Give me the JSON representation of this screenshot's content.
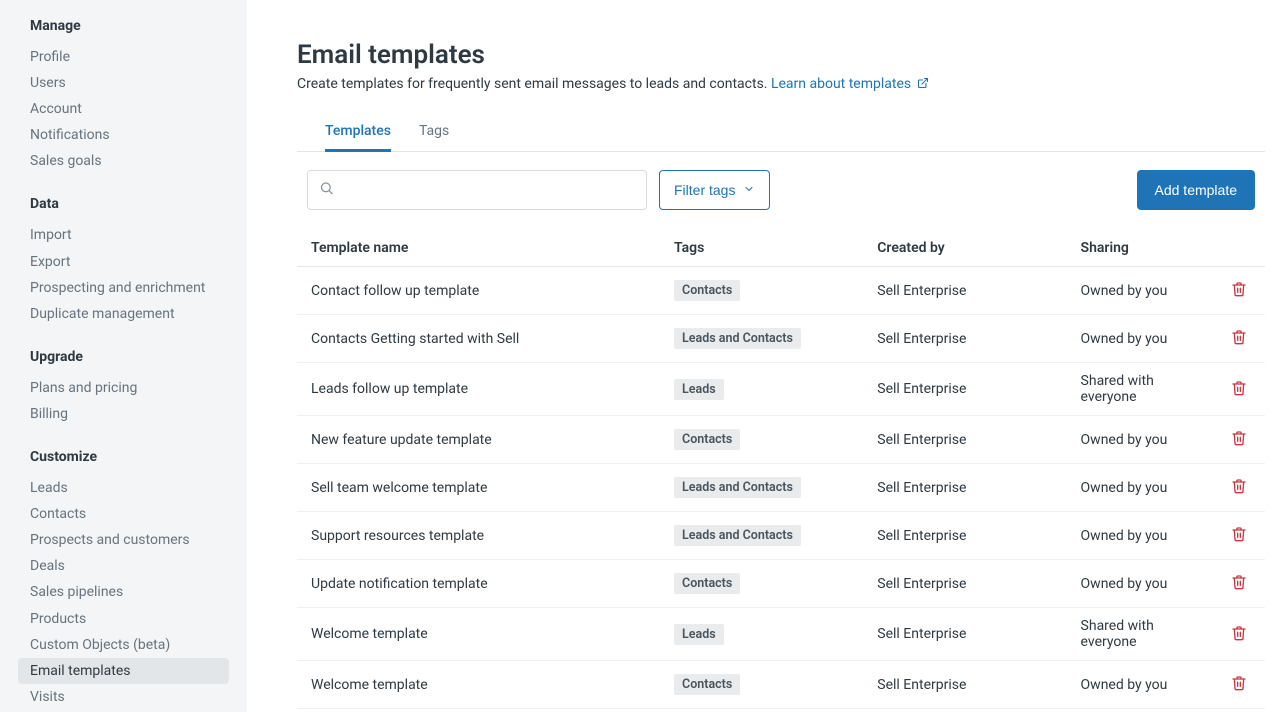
{
  "sidebar": {
    "sections": [
      {
        "heading": "Manage",
        "items": [
          {
            "label": "Profile",
            "name": "sidebar-item-profile",
            "active": false
          },
          {
            "label": "Users",
            "name": "sidebar-item-users",
            "active": false
          },
          {
            "label": "Account",
            "name": "sidebar-item-account",
            "active": false
          },
          {
            "label": "Notifications",
            "name": "sidebar-item-notifications",
            "active": false
          },
          {
            "label": "Sales goals",
            "name": "sidebar-item-sales-goals",
            "active": false
          }
        ]
      },
      {
        "heading": "Data",
        "items": [
          {
            "label": "Import",
            "name": "sidebar-item-import",
            "active": false
          },
          {
            "label": "Export",
            "name": "sidebar-item-export",
            "active": false
          },
          {
            "label": "Prospecting and enrichment",
            "name": "sidebar-item-prospecting",
            "active": false
          },
          {
            "label": "Duplicate management",
            "name": "sidebar-item-duplicates",
            "active": false
          }
        ]
      },
      {
        "heading": "Upgrade",
        "items": [
          {
            "label": "Plans and pricing",
            "name": "sidebar-item-plans",
            "active": false
          },
          {
            "label": "Billing",
            "name": "sidebar-item-billing",
            "active": false
          }
        ]
      },
      {
        "heading": "Customize",
        "items": [
          {
            "label": "Leads",
            "name": "sidebar-item-leads",
            "active": false
          },
          {
            "label": "Contacts",
            "name": "sidebar-item-contacts",
            "active": false
          },
          {
            "label": "Prospects and customers",
            "name": "sidebar-item-prospects",
            "active": false
          },
          {
            "label": "Deals",
            "name": "sidebar-item-deals",
            "active": false
          },
          {
            "label": "Sales pipelines",
            "name": "sidebar-item-pipelines",
            "active": false
          },
          {
            "label": "Products",
            "name": "sidebar-item-products",
            "active": false
          },
          {
            "label": "Custom Objects (beta)",
            "name": "sidebar-item-custom-obj",
            "active": false
          },
          {
            "label": "Email templates",
            "name": "sidebar-item-email-templates",
            "active": true
          },
          {
            "label": "Visits",
            "name": "sidebar-item-visits",
            "active": false
          }
        ]
      }
    ]
  },
  "header": {
    "title": "Email templates",
    "subtitle_prefix": "Create templates for frequently sent email messages to leads and contacts. ",
    "link_text": "Learn about templates"
  },
  "tabs": [
    {
      "label": "Templates",
      "name": "tab-templates",
      "active": true
    },
    {
      "label": "Tags",
      "name": "tab-tags",
      "active": false
    }
  ],
  "toolbar": {
    "search_placeholder": "",
    "filter_label": "Filter tags",
    "add_label": "Add template"
  },
  "table": {
    "columns": {
      "name": "Template name",
      "tags": "Tags",
      "created_by": "Created by",
      "sharing": "Sharing"
    },
    "rows": [
      {
        "name": "Contact follow up template",
        "tag": "Contacts",
        "created_by": "Sell Enterprise",
        "sharing": "Owned by you"
      },
      {
        "name": "Contacts Getting started with Sell",
        "tag": "Leads and Contacts",
        "created_by": "Sell Enterprise",
        "sharing": "Owned by you"
      },
      {
        "name": "Leads follow up template",
        "tag": "Leads",
        "created_by": "Sell Enterprise",
        "sharing": "Shared with everyone"
      },
      {
        "name": "New feature update template",
        "tag": "Contacts",
        "created_by": "Sell Enterprise",
        "sharing": "Owned by you"
      },
      {
        "name": "Sell team welcome template",
        "tag": "Leads and Contacts",
        "created_by": "Sell Enterprise",
        "sharing": "Owned by you"
      },
      {
        "name": "Support resources template",
        "tag": "Leads and Contacts",
        "created_by": "Sell Enterprise",
        "sharing": "Owned by you"
      },
      {
        "name": "Update notification template",
        "tag": "Contacts",
        "created_by": "Sell Enterprise",
        "sharing": "Owned by you"
      },
      {
        "name": "Welcome template",
        "tag": "Leads",
        "created_by": "Sell Enterprise",
        "sharing": "Shared with everyone"
      },
      {
        "name": "Welcome template",
        "tag": "Contacts",
        "created_by": "Sell Enterprise",
        "sharing": "Owned by you"
      }
    ]
  },
  "colors": {
    "link": "#1f73b7",
    "primary": "#1f73b7",
    "danger": "#cc3340",
    "sidebar_bg": "#f3f5f7"
  }
}
